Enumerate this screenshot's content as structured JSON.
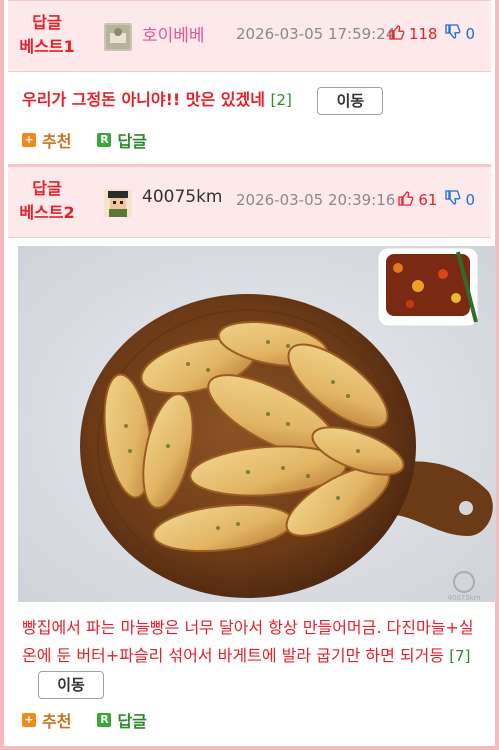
{
  "posts": [
    {
      "best_label": "답글\n베스트1",
      "author": "호이베베",
      "date": "2026-03-05 17:59:24",
      "upvotes": "118",
      "downvotes": "0",
      "comment": "우리가 그정돈 아니야!! 맛은 있겠네",
      "reply_count": "[2]",
      "move_label": "이동",
      "recommend_label": "추천",
      "reply_label": "답글"
    },
    {
      "best_label": "답글\n베스트2",
      "author": "40075km",
      "date": "2026-03-05 20:39:16",
      "upvotes": "61",
      "downvotes": "0",
      "comment": "빵집에서 파는 마늘빵은 너무 달아서 항상 만들어머금. 다진마늘+실온에 둔 버터+파슬리 섞어서 바게트에 발라 굽기만 하면 되거등",
      "reply_count": "[7]",
      "move_label": "이동",
      "recommend_label": "추천",
      "reply_label": "답글",
      "image_watermark": "40075km"
    }
  ],
  "colors": {
    "accent_red": "#e8202a",
    "header_bg": "#fde8ea",
    "border_pink": "#f6b9bd",
    "author_pink": "#e0589a",
    "down_blue": "#1c6ed8",
    "reply_green": "#2c8a2c",
    "recommend_orange": "#f08a1a"
  },
  "icons": {
    "upvote": "thumbs-up-icon",
    "downvote": "thumbs-down-icon",
    "recommend": "plus-square-icon",
    "reply": "r-square-icon"
  }
}
